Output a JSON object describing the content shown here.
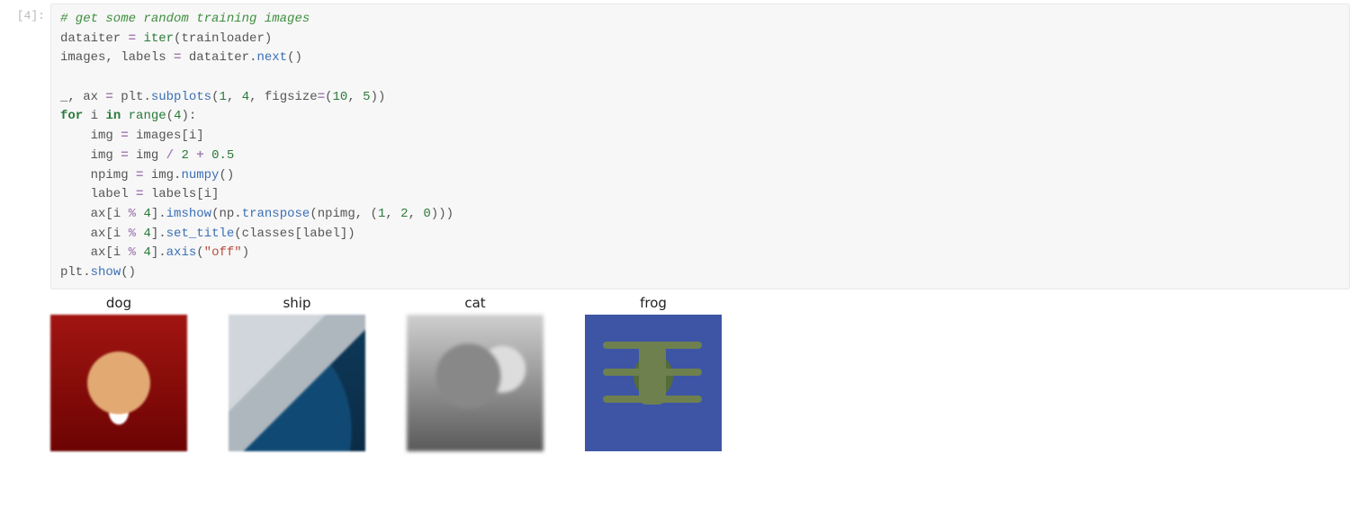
{
  "cell": {
    "prompt": "[4]:",
    "code_lines": [
      [
        [
          "c",
          "# get some random training images"
        ]
      ],
      [
        [
          "nm",
          "dataiter "
        ],
        [
          "op",
          "="
        ],
        [
          "nm",
          " "
        ],
        [
          "bi",
          "iter"
        ],
        [
          "pn",
          "(trainloader)"
        ]
      ],
      [
        [
          "nm",
          "images, labels "
        ],
        [
          "op",
          "="
        ],
        [
          "nm",
          " dataiter"
        ],
        [
          "pn",
          "."
        ],
        [
          "fn",
          "next"
        ],
        [
          "pn",
          "()"
        ]
      ],
      [
        [
          "nm",
          ""
        ]
      ],
      [
        [
          "nm",
          "_, ax "
        ],
        [
          "op",
          "="
        ],
        [
          "nm",
          " plt"
        ],
        [
          "pn",
          "."
        ],
        [
          "fn",
          "subplots"
        ],
        [
          "pn",
          "("
        ],
        [
          "nb",
          "1"
        ],
        [
          "pn",
          ", "
        ],
        [
          "nb",
          "4"
        ],
        [
          "pn",
          ", figsize"
        ],
        [
          "op",
          "="
        ],
        [
          "pn",
          "("
        ],
        [
          "nb",
          "10"
        ],
        [
          "pn",
          ", "
        ],
        [
          "nb",
          "5"
        ],
        [
          "pn",
          "))"
        ]
      ],
      [
        [
          "kw",
          "for"
        ],
        [
          "nm",
          " i "
        ],
        [
          "kw",
          "in"
        ],
        [
          "nm",
          " "
        ],
        [
          "bi",
          "range"
        ],
        [
          "pn",
          "("
        ],
        [
          "nb",
          "4"
        ],
        [
          "pn",
          "):"
        ]
      ],
      [
        [
          "nm",
          "    img "
        ],
        [
          "op",
          "="
        ],
        [
          "nm",
          " images[i]"
        ]
      ],
      [
        [
          "nm",
          "    img "
        ],
        [
          "op",
          "="
        ],
        [
          "nm",
          " img "
        ],
        [
          "op",
          "/"
        ],
        [
          "nm",
          " "
        ],
        [
          "nb",
          "2"
        ],
        [
          "nm",
          " "
        ],
        [
          "op",
          "+"
        ],
        [
          "nm",
          " "
        ],
        [
          "nb",
          "0.5"
        ]
      ],
      [
        [
          "nm",
          "    npimg "
        ],
        [
          "op",
          "="
        ],
        [
          "nm",
          " img"
        ],
        [
          "pn",
          "."
        ],
        [
          "fn",
          "numpy"
        ],
        [
          "pn",
          "()"
        ]
      ],
      [
        [
          "nm",
          "    label "
        ],
        [
          "op",
          "="
        ],
        [
          "nm",
          " labels[i]"
        ]
      ],
      [
        [
          "nm",
          "    ax[i "
        ],
        [
          "op",
          "%"
        ],
        [
          "nm",
          " "
        ],
        [
          "nb",
          "4"
        ],
        [
          "nm",
          "]"
        ],
        [
          "pn",
          "."
        ],
        [
          "fn",
          "imshow"
        ],
        [
          "pn",
          "(np"
        ],
        [
          "pn",
          "."
        ],
        [
          "fn",
          "transpose"
        ],
        [
          "pn",
          "(npimg, ("
        ],
        [
          "nb",
          "1"
        ],
        [
          "pn",
          ", "
        ],
        [
          "nb",
          "2"
        ],
        [
          "pn",
          ", "
        ],
        [
          "nb",
          "0"
        ],
        [
          "pn",
          ")))"
        ]
      ],
      [
        [
          "nm",
          "    ax[i "
        ],
        [
          "op",
          "%"
        ],
        [
          "nm",
          " "
        ],
        [
          "nb",
          "4"
        ],
        [
          "nm",
          "]"
        ],
        [
          "pn",
          "."
        ],
        [
          "fn",
          "set_title"
        ],
        [
          "pn",
          "(classes[label])"
        ]
      ],
      [
        [
          "nm",
          "    ax[i "
        ],
        [
          "op",
          "%"
        ],
        [
          "nm",
          " "
        ],
        [
          "nb",
          "4"
        ],
        [
          "nm",
          "]"
        ],
        [
          "pn",
          "."
        ],
        [
          "fn",
          "axis"
        ],
        [
          "pn",
          "("
        ],
        [
          "st",
          "\"off\""
        ],
        [
          "pn",
          ")"
        ]
      ],
      [
        [
          "nm",
          "plt"
        ],
        [
          "pn",
          "."
        ],
        [
          "fn",
          "show"
        ],
        [
          "pn",
          "()"
        ]
      ]
    ]
  },
  "chart_data": {
    "type": "image-grid",
    "rows": 1,
    "cols": 4,
    "figsize": [
      10,
      5
    ],
    "axis": "off",
    "subplots": [
      {
        "title": "dog",
        "class": "dog"
      },
      {
        "title": "ship",
        "class": "ship"
      },
      {
        "title": "cat",
        "class": "cat"
      },
      {
        "title": "frog",
        "class": "frog"
      }
    ]
  }
}
